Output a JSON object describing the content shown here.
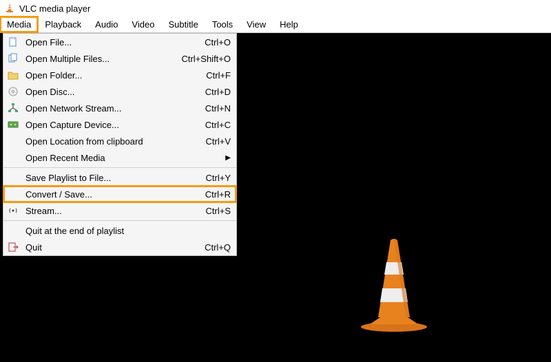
{
  "title": "VLC media player",
  "menubar": [
    "Media",
    "Playback",
    "Audio",
    "Video",
    "Subtitle",
    "Tools",
    "View",
    "Help"
  ],
  "active_menu_index": 0,
  "dropdown": {
    "items": [
      {
        "icon": "file-icon",
        "label": "Open File...",
        "shortcut": "Ctrl+O"
      },
      {
        "icon": "files-icon",
        "label": "Open Multiple Files...",
        "shortcut": "Ctrl+Shift+O"
      },
      {
        "icon": "folder-icon",
        "label": "Open Folder...",
        "shortcut": "Ctrl+F"
      },
      {
        "icon": "disc-icon",
        "label": "Open Disc...",
        "shortcut": "Ctrl+D"
      },
      {
        "icon": "network-icon",
        "label": "Open Network Stream...",
        "shortcut": "Ctrl+N"
      },
      {
        "icon": "capture-icon",
        "label": "Open Capture Device...",
        "shortcut": "Ctrl+C"
      },
      {
        "icon": "",
        "label": "Open Location from clipboard",
        "shortcut": "Ctrl+V"
      },
      {
        "icon": "",
        "label": "Open Recent Media",
        "shortcut": "",
        "submenu": true
      },
      {
        "separator": true
      },
      {
        "icon": "",
        "label": "Save Playlist to File...",
        "shortcut": "Ctrl+Y"
      },
      {
        "icon": "",
        "label": "Convert / Save...",
        "shortcut": "Ctrl+R",
        "highlight": true
      },
      {
        "icon": "stream-icon",
        "label": "Stream...",
        "shortcut": "Ctrl+S"
      },
      {
        "separator": true
      },
      {
        "icon": "",
        "label": "Quit at the end of playlist",
        "shortcut": ""
      },
      {
        "icon": "quit-icon",
        "label": "Quit",
        "shortcut": "Ctrl+Q"
      }
    ]
  }
}
